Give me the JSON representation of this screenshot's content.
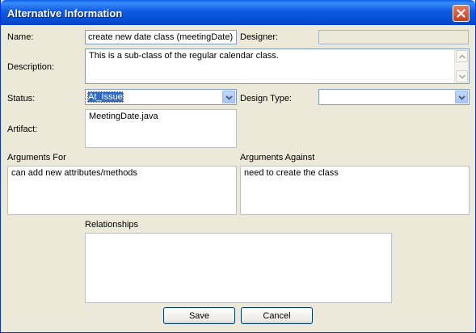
{
  "window": {
    "title": "Alternative Information"
  },
  "form": {
    "name_label": "Name:",
    "name_value": "create new date class (meetingDate)",
    "designer_label": "Designer:",
    "designer_value": "",
    "description_label": "Description:",
    "description_value": "This is a sub-class of the regular calendar class.",
    "status_label": "Status:",
    "status_value": "At_Issue",
    "design_type_label": "Design Type:",
    "design_type_value": "",
    "artifact_label": "Artifact:",
    "artifact_value": "MeetingDate.java",
    "args_for_label": "Arguments For",
    "args_for_value": "can add new attributes/methods",
    "args_against_label": "Arguments Against",
    "args_against_value": "need to create the class",
    "relationships_label": "Relationships",
    "relationships_value": ""
  },
  "buttons": {
    "save": "Save",
    "cancel": "Cancel"
  },
  "icons": {
    "close": "close-icon",
    "dropdown": "chevron-down-icon",
    "scroll_up": "arrow-up-icon",
    "scroll_down": "arrow-down-icon"
  },
  "colors": {
    "titlebar": "#0a5fe6",
    "dialog_bg": "#ece9d8",
    "field_border": "#7f9db9",
    "selection": "#316ac5"
  }
}
